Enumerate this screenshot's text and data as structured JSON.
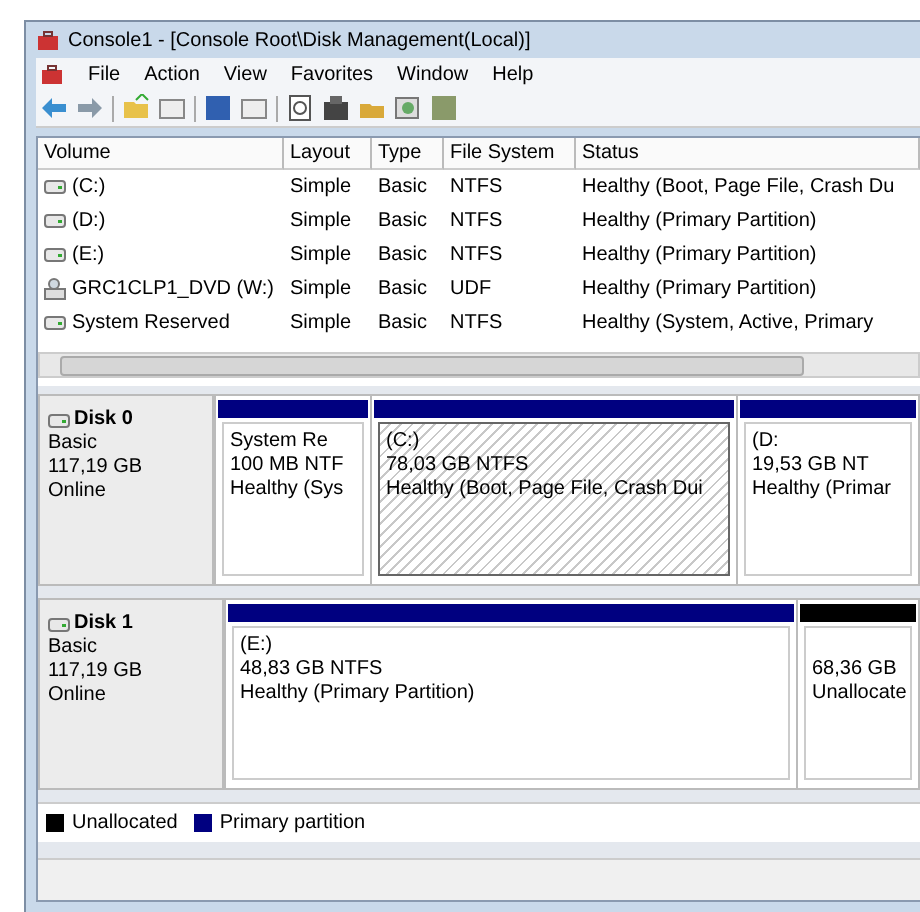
{
  "window": {
    "title": "Console1 - [Console Root\\Disk Management(Local)]"
  },
  "menu": [
    "File",
    "Action",
    "View",
    "Favorites",
    "Window",
    "Help"
  ],
  "table": {
    "columns": [
      "Volume",
      "Layout",
      "Type",
      "File System",
      "Status"
    ],
    "rows": [
      {
        "kind": "disk",
        "cells": [
          "(C:)",
          "Simple",
          "Basic",
          "NTFS",
          "Healthy (Boot, Page File, Crash Du"
        ]
      },
      {
        "kind": "disk",
        "cells": [
          "(D:)",
          "Simple",
          "Basic",
          "NTFS",
          "Healthy (Primary Partition)"
        ]
      },
      {
        "kind": "disk",
        "cells": [
          "(E:)",
          "Simple",
          "Basic",
          "NTFS",
          "Healthy (Primary Partition)"
        ]
      },
      {
        "kind": "dvd",
        "cells": [
          "GRC1CLP1_DVD (W:)",
          "Simple",
          "Basic",
          "UDF",
          "Healthy (Primary Partition)"
        ]
      },
      {
        "kind": "disk",
        "cells": [
          "System Reserved",
          "Simple",
          "Basic",
          "NTFS",
          "Healthy (System, Active, Primary"
        ]
      }
    ]
  },
  "disks": [
    {
      "name": "Disk 0",
      "type": "Basic",
      "size": "117,19 GB",
      "status": "Online",
      "partitions": [
        {
          "kind": "primary",
          "selected": false,
          "label": "System Re",
          "size": "100 MB NTF",
          "status": "Healthy (Sys"
        },
        {
          "kind": "primary",
          "selected": true,
          "label": "(C:)",
          "size": "78,03 GB NTFS",
          "status": "Healthy (Boot, Page File, Crash Dui"
        },
        {
          "kind": "primary",
          "selected": false,
          "label": "(D:",
          "size": "19,53 GB NT",
          "status": "Healthy (Primar"
        }
      ]
    },
    {
      "name": "Disk 1",
      "type": "Basic",
      "size": "117,19 GB",
      "status": "Online",
      "partitions": [
        {
          "kind": "primary",
          "selected": false,
          "label": "(E:)",
          "size": "48,83 GB NTFS",
          "status": "Healthy (Primary Partition)"
        },
        {
          "kind": "unallocated",
          "selected": false,
          "size": "68,36 GB",
          "status": "Unallocate"
        }
      ]
    }
  ],
  "legend": [
    {
      "label": "Unallocated",
      "color": "#000000"
    },
    {
      "label": "Primary partition",
      "color": "#000080"
    }
  ]
}
